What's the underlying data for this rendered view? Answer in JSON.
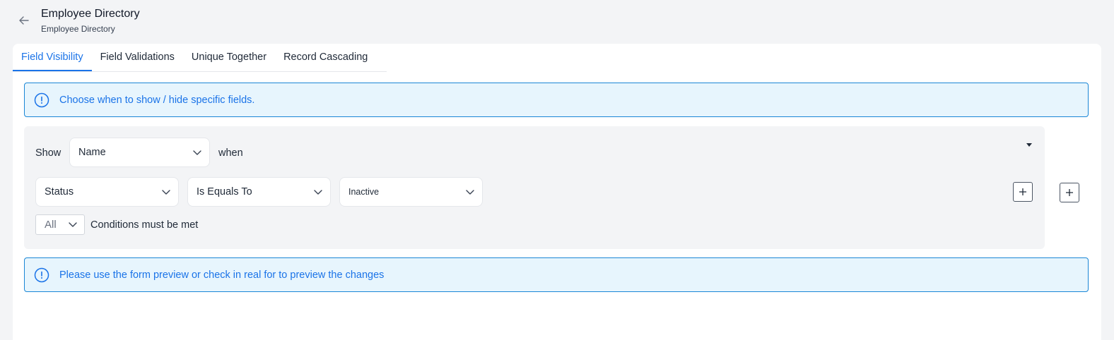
{
  "header": {
    "title": "Employee Directory",
    "subtitle": "Employee Directory",
    "back_icon": "arrow-left-icon"
  },
  "tabs": [
    {
      "label": "Field Visibility",
      "active": true
    },
    {
      "label": "Field Validations",
      "active": false
    },
    {
      "label": "Unique Together",
      "active": false
    },
    {
      "label": "Record Cascading",
      "active": false
    }
  ],
  "info_top": {
    "icon": "info-circle-icon",
    "text": "Choose when to show / hide specific fields."
  },
  "rule": {
    "show_label": "Show",
    "field_value": "Name",
    "when_label": "when",
    "condition": {
      "field": "Status",
      "operator": "Is Equals To",
      "value": "Inactive"
    },
    "match_mode": "All",
    "match_suffix": "Conditions must be met"
  },
  "info_bottom": {
    "icon": "info-circle-icon",
    "text": "Please use the form preview or check in real for to preview the changes"
  },
  "colors": {
    "accent": "#1a73e8",
    "info_bg": "#e7f5fd",
    "info_border": "#1a86d6",
    "page_bg": "#f3f4f6"
  }
}
